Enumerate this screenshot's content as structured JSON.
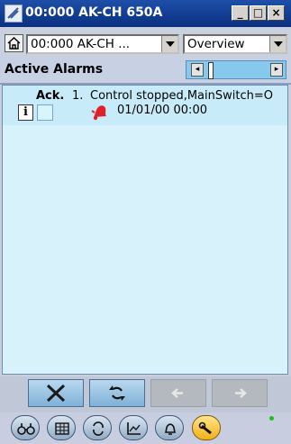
{
  "window": {
    "title": "00:000 AK-CH 650A",
    "minimize_label": "_",
    "maximize_label": "□",
    "close_label": "×"
  },
  "toolbar": {
    "device_combo_value": "00:000 AK-CH ...",
    "view_combo_value": "Overview"
  },
  "alarms_header": {
    "title": "Active Alarms"
  },
  "alarm_list": {
    "items": [
      {
        "ack_label": "Ack.",
        "index": "1.",
        "text": "Control stopped,MainSwitch=O",
        "datetime": "01/01/00 00:00",
        "info_label": "i"
      }
    ]
  },
  "colors": {
    "titlebar": "#0a2f80",
    "list_background": "#d7f2fa",
    "alarm_bell": "#e0202a",
    "selected_nav": "#f1b018",
    "status_led": "#1fbf1f"
  },
  "icons": {
    "clear": "close-icon",
    "acknowledge": "refresh-arrows-icon",
    "prev": "arrow-left-icon",
    "next": "arrow-right-icon"
  }
}
